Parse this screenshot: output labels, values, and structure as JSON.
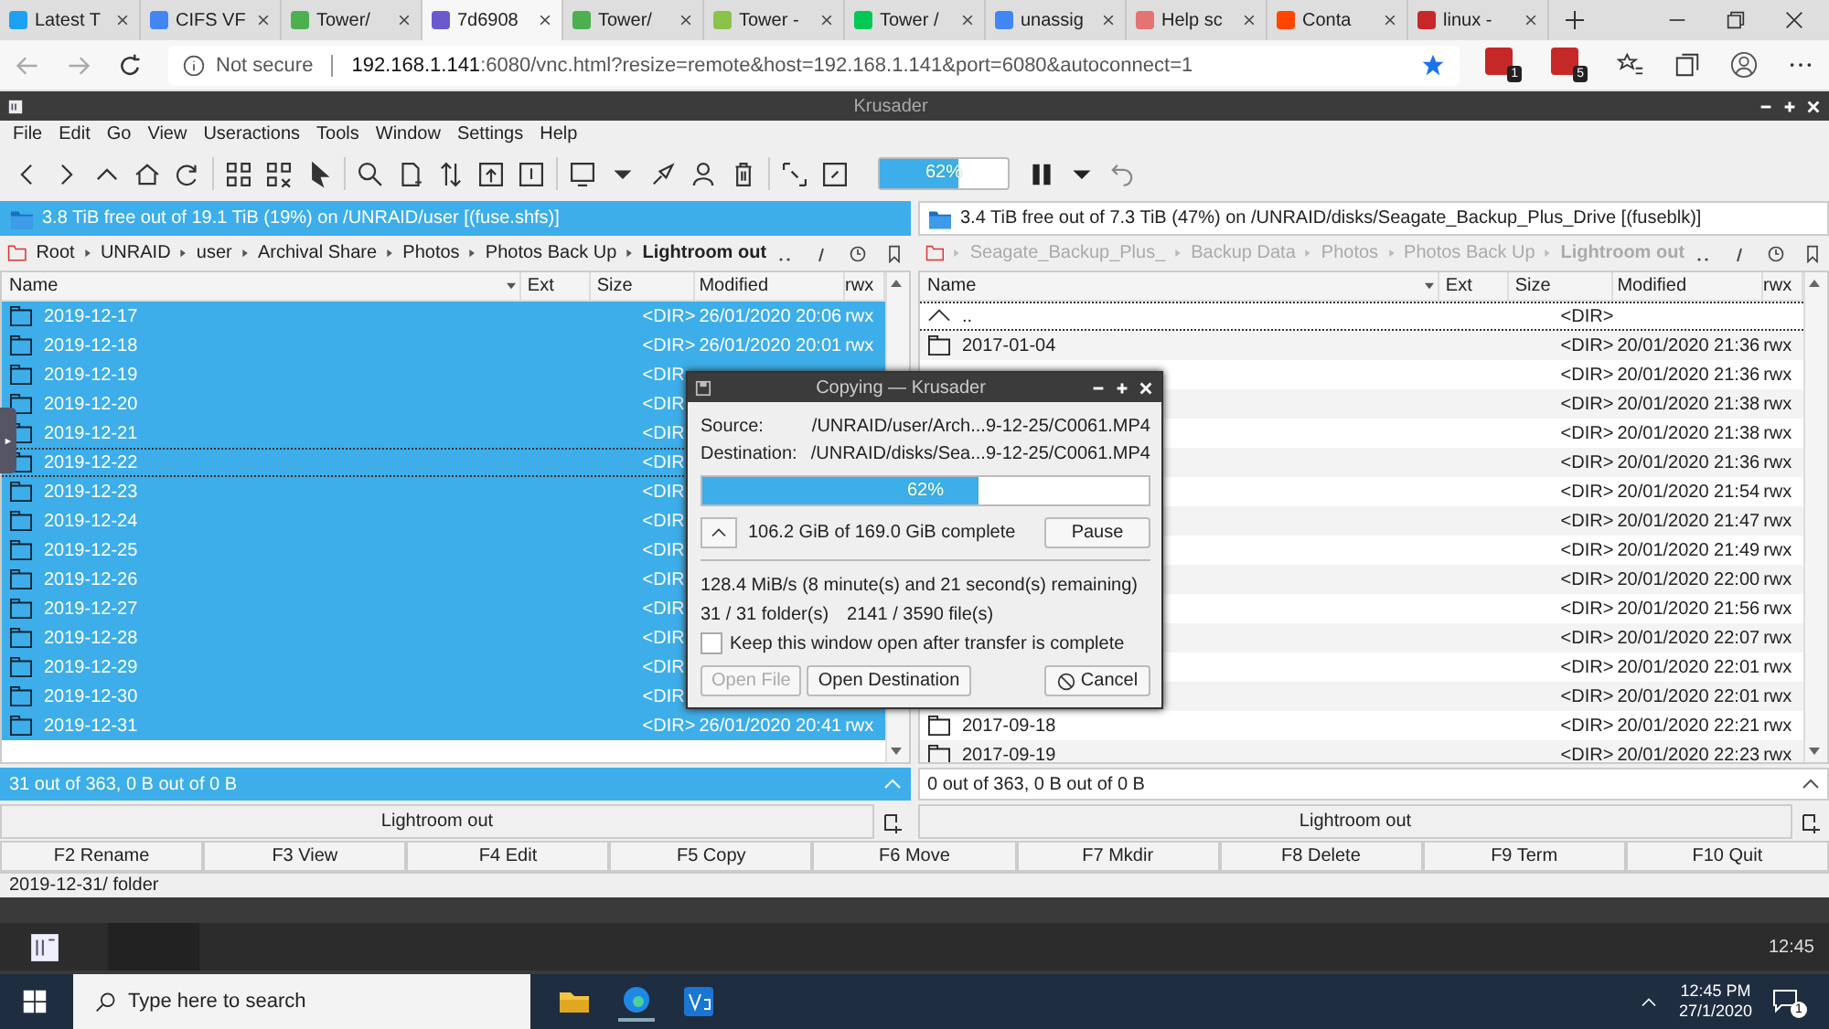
{
  "browser": {
    "tabs": [
      {
        "title": "Latest T",
        "selected": false,
        "color": "#1da1f2"
      },
      {
        "title": "CIFS VF",
        "selected": false,
        "color": "#4285f4"
      },
      {
        "title": "Tower/",
        "selected": false,
        "color": "#4caf50"
      },
      {
        "title": "7d6908",
        "selected": true,
        "color": "#6a5acd"
      },
      {
        "title": "Tower/",
        "selected": false,
        "color": "#4caf50"
      },
      {
        "title": "Tower -",
        "selected": false,
        "color": "#8bc34a"
      },
      {
        "title": "Tower /",
        "selected": false,
        "color": "#00c853"
      },
      {
        "title": "unassig",
        "selected": false,
        "color": "#4285f4"
      },
      {
        "title": "Help sc",
        "selected": false,
        "color": "#e57373"
      },
      {
        "title": "Conta",
        "selected": false,
        "color": "#ff4500"
      },
      {
        "title": "linux -",
        "selected": false,
        "color": "#c62828"
      }
    ],
    "security": "Not secure",
    "host": "192.168.1.141",
    "path": ":6080/vnc.html?resize=remote&host=192.168.1.141&port=6080&autoconnect=1",
    "badges": [
      "1",
      "5"
    ]
  },
  "krusader": {
    "title": "Krusader",
    "menu": [
      "File",
      "Edit",
      "Go",
      "View",
      "Useractions",
      "Tools",
      "Window",
      "Settings",
      "Help"
    ],
    "progress": {
      "level": 0.62,
      "text": "62%"
    }
  },
  "panels": [
    {
      "active": true,
      "free_space": "3.8 TiB free out of 19.1 TiB (19%) on /UNRAID/user [(fuse.shfs)]",
      "breadcrumb": [
        "Root",
        "UNRAID",
        "user",
        "Archival Share",
        "Photos",
        "Photos Back Up",
        "Lightroom out"
      ],
      "columns": [
        "Name",
        "Ext",
        "Size",
        "Modified",
        "rwx"
      ],
      "rows": [
        {
          "kind": "folder",
          "name": "2019-12-17",
          "size": "<DIR>",
          "modified": "26/01/2020 20:06",
          "rwx": "rwx",
          "selected": true,
          "current": false
        },
        {
          "kind": "folder",
          "name": "2019-12-18",
          "size": "<DIR>",
          "modified": "26/01/2020 20:01",
          "rwx": "rwx",
          "selected": true,
          "current": false
        },
        {
          "kind": "folder",
          "name": "2019-12-19",
          "size": "<DIR",
          "selected": true,
          "current": false
        },
        {
          "kind": "folder",
          "name": "2019-12-20",
          "size": "<DIR",
          "selected": true,
          "current": false
        },
        {
          "kind": "folder",
          "name": "2019-12-21",
          "size": "<DIR",
          "selected": true,
          "current": false
        },
        {
          "kind": "folder",
          "name": "2019-12-22",
          "size": "<DIR",
          "selected": true,
          "current": true
        },
        {
          "kind": "folder",
          "name": "2019-12-23",
          "size": "<DIR",
          "selected": true,
          "current": false
        },
        {
          "kind": "folder",
          "name": "2019-12-24",
          "size": "<DIR",
          "selected": true,
          "current": false
        },
        {
          "kind": "folder",
          "name": "2019-12-25",
          "size": "<DIR",
          "selected": true,
          "current": false
        },
        {
          "kind": "folder",
          "name": "2019-12-26",
          "size": "<DIR",
          "selected": true,
          "current": false
        },
        {
          "kind": "folder",
          "name": "2019-12-27",
          "size": "<DIR",
          "selected": true,
          "current": false
        },
        {
          "kind": "folder",
          "name": "2019-12-28",
          "size": "<DIR",
          "selected": true,
          "current": false
        },
        {
          "kind": "folder",
          "name": "2019-12-29",
          "size": "<DIR",
          "selected": true,
          "current": false
        },
        {
          "kind": "folder",
          "name": "2019-12-30",
          "size": "<DIR",
          "selected": true,
          "current": false
        },
        {
          "kind": "folder",
          "name": "2019-12-31",
          "size": "<DIR>",
          "modified": "26/01/2020 20:41",
          "rwx": "rwx",
          "selected": true,
          "current": false
        }
      ],
      "status": "31 out of 363, 0 B out of 0 B",
      "footer": "Lightroom out"
    },
    {
      "active": false,
      "free_space": "3.4 TiB free out of 7.3 TiB (47%) on /UNRAID/disks/Seagate_Backup_Plus_Drive [(fuseblk)]",
      "breadcrumb": [
        "Seagate_Backup_Plus_",
        "Backup Data",
        "Photos",
        "Photos Back Up",
        "Lightroom out"
      ],
      "columns": [
        "Name",
        "Ext",
        "Size",
        "Modified",
        "rwx"
      ],
      "rows": [
        {
          "kind": "up",
          "name": "..",
          "size": "<DIR>",
          "selected": false,
          "current": true
        },
        {
          "kind": "folder",
          "name": "2017-01-04",
          "size": "<DIR>",
          "modified": "20/01/2020 21:36",
          "rwx": "rwx",
          "selected": false,
          "current": false
        },
        {
          "kind": "folder",
          "size": "<DIR>",
          "modified": "20/01/2020 21:36",
          "rwx": "rwx",
          "selected": false,
          "current": false
        },
        {
          "kind": "folder",
          "size": "<DIR>",
          "modified": "20/01/2020 21:38",
          "rwx": "rwx",
          "selected": false,
          "current": false
        },
        {
          "kind": "folder",
          "size": "<DIR>",
          "modified": "20/01/2020 21:38",
          "rwx": "rwx",
          "selected": false,
          "current": false
        },
        {
          "kind": "folder",
          "size": "<DIR>",
          "modified": "20/01/2020 21:36",
          "rwx": "rwx",
          "selected": false,
          "current": false
        },
        {
          "kind": "folder",
          "size": "<DIR>",
          "modified": "20/01/2020 21:54",
          "rwx": "rwx",
          "selected": false,
          "current": false
        },
        {
          "kind": "folder",
          "size": "<DIR>",
          "modified": "20/01/2020 21:47",
          "rwx": "rwx",
          "selected": false,
          "current": false
        },
        {
          "kind": "folder",
          "size": "<DIR>",
          "modified": "20/01/2020 21:49",
          "rwx": "rwx",
          "selected": false,
          "current": false
        },
        {
          "kind": "folder",
          "size": "<DIR>",
          "modified": "20/01/2020 22:00",
          "rwx": "rwx",
          "selected": false,
          "current": false
        },
        {
          "kind": "folder",
          "size": "<DIR>",
          "modified": "20/01/2020 21:56",
          "rwx": "rwx",
          "selected": false,
          "current": false
        },
        {
          "kind": "folder",
          "size": "<DIR>",
          "modified": "20/01/2020 22:07",
          "rwx": "rwx",
          "selected": false,
          "current": false
        },
        {
          "kind": "folder",
          "size": "<DIR>",
          "modified": "20/01/2020 22:01",
          "rwx": "rwx",
          "selected": false,
          "current": false
        },
        {
          "kind": "folder",
          "size": "<DIR>",
          "modified": "20/01/2020 22:01",
          "rwx": "rwx",
          "selected": false,
          "current": false
        },
        {
          "kind": "folder",
          "name": "2017-09-18",
          "size": "<DIR>",
          "modified": "20/01/2020 22:21",
          "rwx": "rwx",
          "selected": false,
          "current": false
        },
        {
          "kind": "folder",
          "name": "2017-09-19",
          "size": "<DIR>",
          "modified": "20/01/2020 22:23",
          "rwx": "rwx",
          "selected": false,
          "current": false
        }
      ],
      "status": "0 out of 363, 0 B out of 0 B",
      "footer": "Lightroom out"
    }
  ],
  "fkeys": [
    {
      "key": "F2",
      "label": "Rename"
    },
    {
      "key": "F3",
      "label": "View"
    },
    {
      "key": "F4",
      "label": "Edit"
    },
    {
      "key": "F5",
      "label": "Copy"
    },
    {
      "key": "F6",
      "label": "Move"
    },
    {
      "key": "F7",
      "label": "Mkdir"
    },
    {
      "key": "F8",
      "label": "Delete"
    },
    {
      "key": "F9",
      "label": "Term"
    },
    {
      "key": "F10",
      "label": "Quit"
    }
  ],
  "command_line": "2019-12-31/  folder",
  "dialog": {
    "title": "Copying — Krusader",
    "source_label": "Source:",
    "source": "/UNRAID/user/Arch...9-12-25/C0061.MP4",
    "destination_label": "Destination:",
    "destination": "/UNRAID/disks/Sea...9-12-25/C0061.MP4",
    "progress": {
      "level": 0.62,
      "text": "62%"
    },
    "complete": "106.2 GiB of 169.0 GiB complete",
    "pause": "Pause",
    "speed": "128.4 MiB/s (8 minute(s) and 21 second(s) remaining)",
    "folders": "31 / 31 folder(s)",
    "files": "2141 / 3590 file(s)",
    "keep_open": {
      "label": "Keep this window open after transfer is complete",
      "checked": false
    },
    "buttons": [
      {
        "kind": "open",
        "label": "Open File",
        "disabled": true
      },
      {
        "kind": "open",
        "label": "Open Destination",
        "disabled": false
      },
      {
        "kind": "cancel",
        "label": "Cancel",
        "disabled": false
      }
    ]
  },
  "vnc_panel": {
    "clock": "12:45"
  },
  "taskbar": {
    "search": {
      "placeholder": "Type here to search"
    },
    "time": "12:45 PM",
    "date": "27/1/2020",
    "notifications": "1"
  }
}
